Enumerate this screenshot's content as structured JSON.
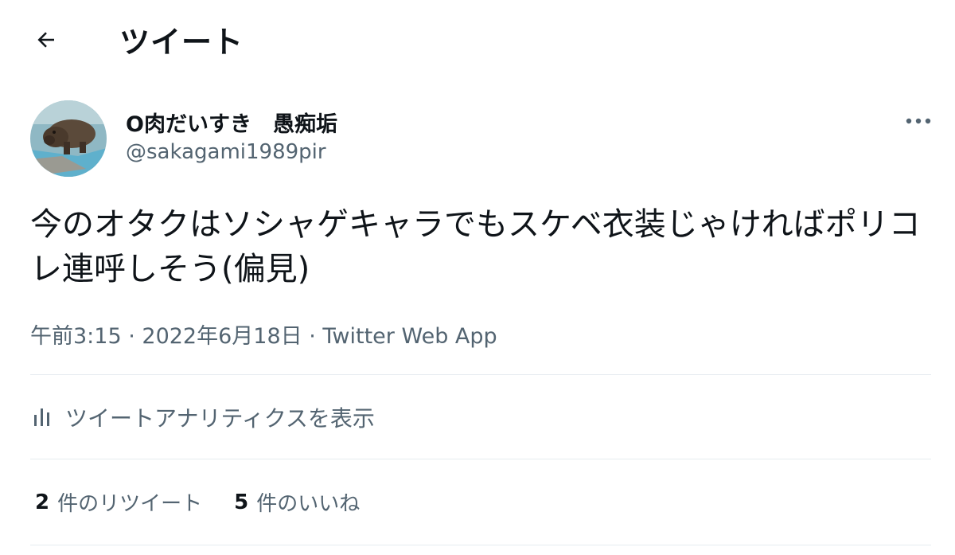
{
  "header": {
    "back_icon": "arrow-left-icon",
    "title": "ツイート"
  },
  "tweet": {
    "author": {
      "display_name": "O肉だいすき　愚痴垢",
      "handle": "@sakagami1989pir"
    },
    "more_icon": "more-horizontal-icon",
    "text": "今のオタクはソシャゲキャラでもスケベ衣装じゃければポリコレ連呼しそう(偏見)",
    "meta": {
      "time": "午前3:15",
      "separator": " · ",
      "date": "2022年6月18日",
      "source": "Twitter Web App"
    },
    "analytics": {
      "icon": "bar-chart-icon",
      "label": "ツイートアナリティクスを表示"
    },
    "stats": {
      "retweets_count": "2",
      "retweets_label": "件のリツイート",
      "likes_count": "5",
      "likes_label": "件のいいね"
    }
  },
  "colors": {
    "text_primary": "#0f1419",
    "text_secondary": "#536471",
    "divider": "#e6ecf0"
  }
}
